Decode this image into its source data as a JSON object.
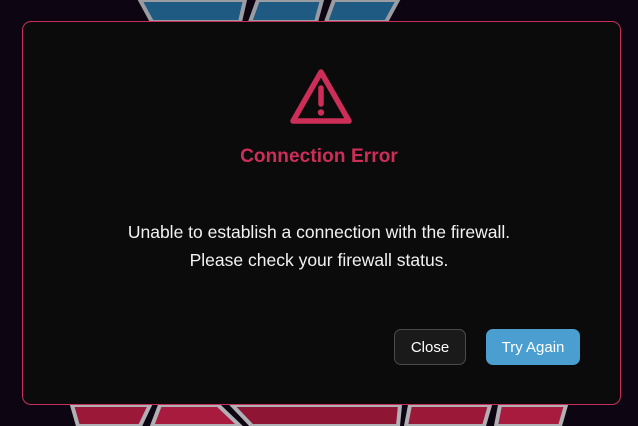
{
  "dialog": {
    "title": "Connection Error",
    "message_line1": "Unable to establish a connection with the firewall.",
    "message_line2": "Please check your firewall status.",
    "close_label": "Close",
    "try_again_label": "Try Again"
  },
  "colors": {
    "accent_error": "#cc2e58",
    "primary_button": "#4a9fd0",
    "dialog_background": "#0b0b0c",
    "dialog_border": "#c6305a"
  },
  "icons": {
    "dialog_icon": "warning-icon"
  }
}
